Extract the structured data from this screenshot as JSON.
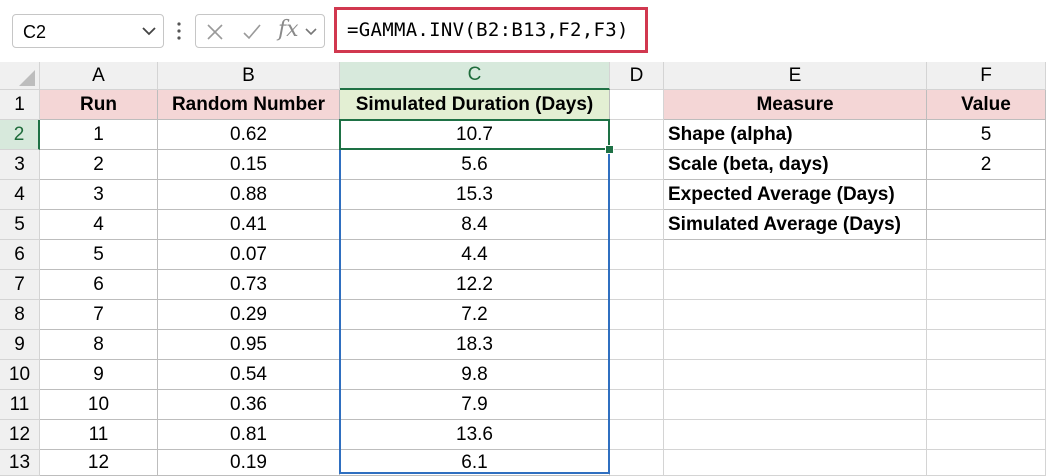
{
  "namebox": {
    "value": "C2"
  },
  "formula_bar": {
    "formula": "=GAMMA.INV(B2:B13,F2,F3)",
    "fx_label": "fx"
  },
  "columns": [
    "A",
    "B",
    "C",
    "D",
    "E",
    "F"
  ],
  "rows": [
    "1",
    "2",
    "3",
    "4",
    "5",
    "6",
    "7",
    "8",
    "9",
    "10",
    "11",
    "12",
    "13"
  ],
  "table1": {
    "headers": [
      "Run",
      "Random Number",
      "Simulated Duration (Days)"
    ],
    "rows": [
      [
        "1",
        "0.62",
        "10.7"
      ],
      [
        "2",
        "0.15",
        "5.6"
      ],
      [
        "3",
        "0.88",
        "15.3"
      ],
      [
        "4",
        "0.41",
        "8.4"
      ],
      [
        "5",
        "0.07",
        "4.4"
      ],
      [
        "6",
        "0.73",
        "12.2"
      ],
      [
        "7",
        "0.29",
        "7.2"
      ],
      [
        "8",
        "0.95",
        "18.3"
      ],
      [
        "9",
        "0.54",
        "9.8"
      ],
      [
        "10",
        "0.36",
        "7.9"
      ],
      [
        "11",
        "0.81",
        "13.6"
      ],
      [
        "12",
        "0.19",
        "6.1"
      ]
    ]
  },
  "table2": {
    "headers": [
      "Measure",
      "Value"
    ],
    "rows": [
      [
        "Shape (alpha)",
        "5"
      ],
      [
        "Scale (beta, days)",
        "2"
      ],
      [
        "Expected Average (Days)",
        ""
      ],
      [
        "Simulated Average (Days)",
        ""
      ]
    ]
  },
  "colors": {
    "header_pink": "#f4d6d6",
    "header_green": "#e3efd3",
    "formula_border": "#d1384f",
    "selection_blue": "#2f6fc0",
    "active_green": "#1e7145"
  }
}
